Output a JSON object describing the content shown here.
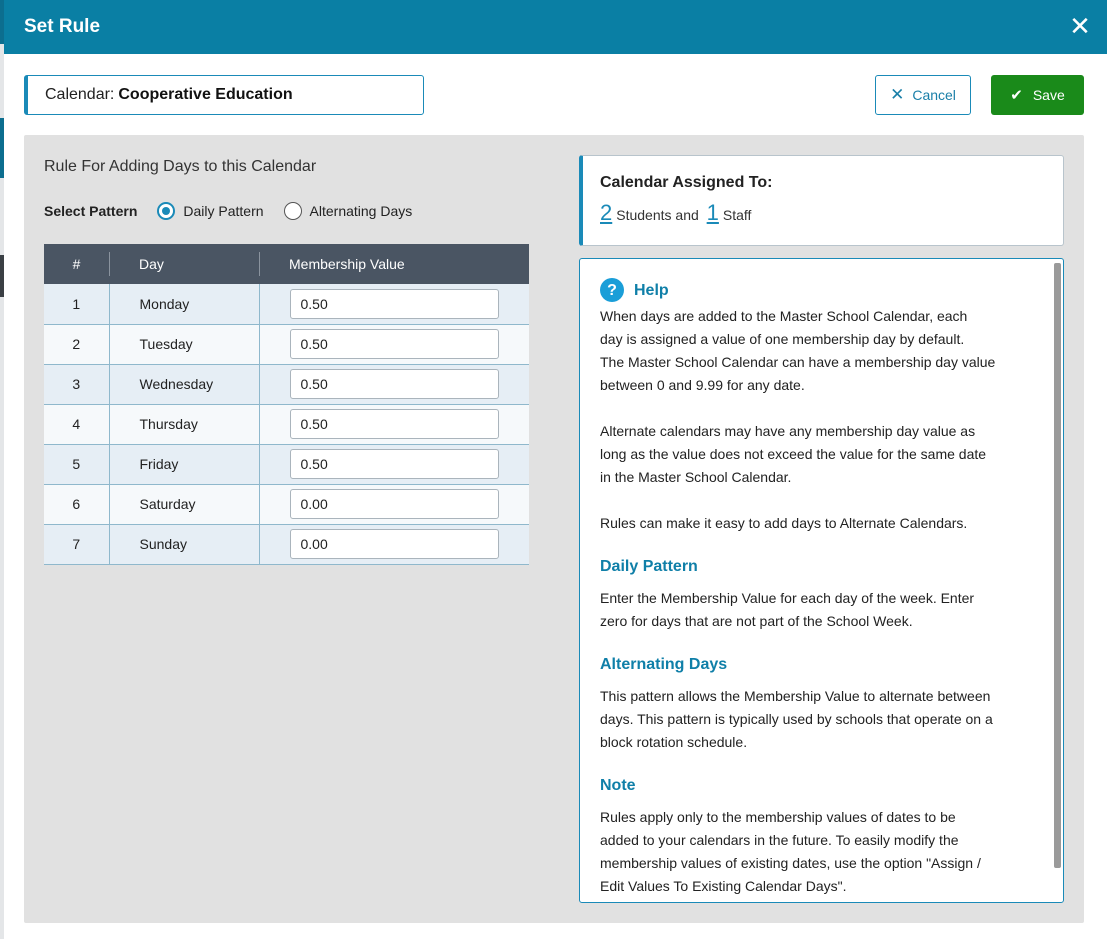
{
  "modal": {
    "title": "Set Rule",
    "close_label": "✕"
  },
  "calendar": {
    "label": "Calendar:",
    "value": "Cooperative Education"
  },
  "buttons": {
    "cancel_label": "Cancel",
    "save_label": "Save"
  },
  "rule": {
    "title": "Rule For Adding Days to this Calendar",
    "select_pattern_label": "Select Pattern",
    "patterns": [
      {
        "label": "Daily Pattern",
        "checked": true
      },
      {
        "label": "Alternating Days",
        "checked": false
      }
    ]
  },
  "table": {
    "headers": [
      "#",
      "Day",
      "Membership Value"
    ],
    "rows": [
      {
        "num": "1",
        "day": "Monday",
        "value": "0.50"
      },
      {
        "num": "2",
        "day": "Tuesday",
        "value": "0.50"
      },
      {
        "num": "3",
        "day": "Wednesday",
        "value": "0.50"
      },
      {
        "num": "4",
        "day": "Thursday",
        "value": "0.50"
      },
      {
        "num": "5",
        "day": "Friday",
        "value": "0.50"
      },
      {
        "num": "6",
        "day": "Saturday",
        "value": "0.00"
      },
      {
        "num": "7",
        "day": "Sunday",
        "value": "0.00"
      }
    ]
  },
  "assigned": {
    "title": "Calendar Assigned To:",
    "students_count": "2",
    "students_label": "Students and",
    "staff_count": "1",
    "staff_label": "Staff"
  },
  "help": {
    "title": "Help",
    "intro_1": "When days are added to the Master School Calendar, each\nday is assigned a value of one membership day by default.\nThe Master School Calendar can have a membership day value\nbetween 0 and 9.99 for any date.",
    "intro_2": "Alternate calendars may have any membership day value as\nlong as the value does not exceed the value for the same date\nin the Master School Calendar.",
    "intro_3": "Rules can make it easy to add days to Alternate Calendars.",
    "daily_title": "Daily Pattern",
    "daily_text": "Enter the Membership Value for each day of the week.  Enter\nzero for days that are not part of the School Week.",
    "alternating_title": "Alternating Days",
    "alternating_text": "This pattern allows the Membership Value to alternate between\ndays. This pattern is typically used by schools that operate on a\nblock rotation schedule.",
    "note_title": "Note",
    "note_text": "Rules apply only to the membership values of dates to be\nadded to your calendars in the future. To easily modify the\nmembership values of existing dates, use the option \"Assign /\nEdit Values To Existing Calendar Days\"."
  },
  "colors": {
    "header_bg": "#0a7fa4",
    "accent": "#1a8ab8",
    "save_bg": "#1a8a1a",
    "table_header_bg": "#4a5563"
  }
}
